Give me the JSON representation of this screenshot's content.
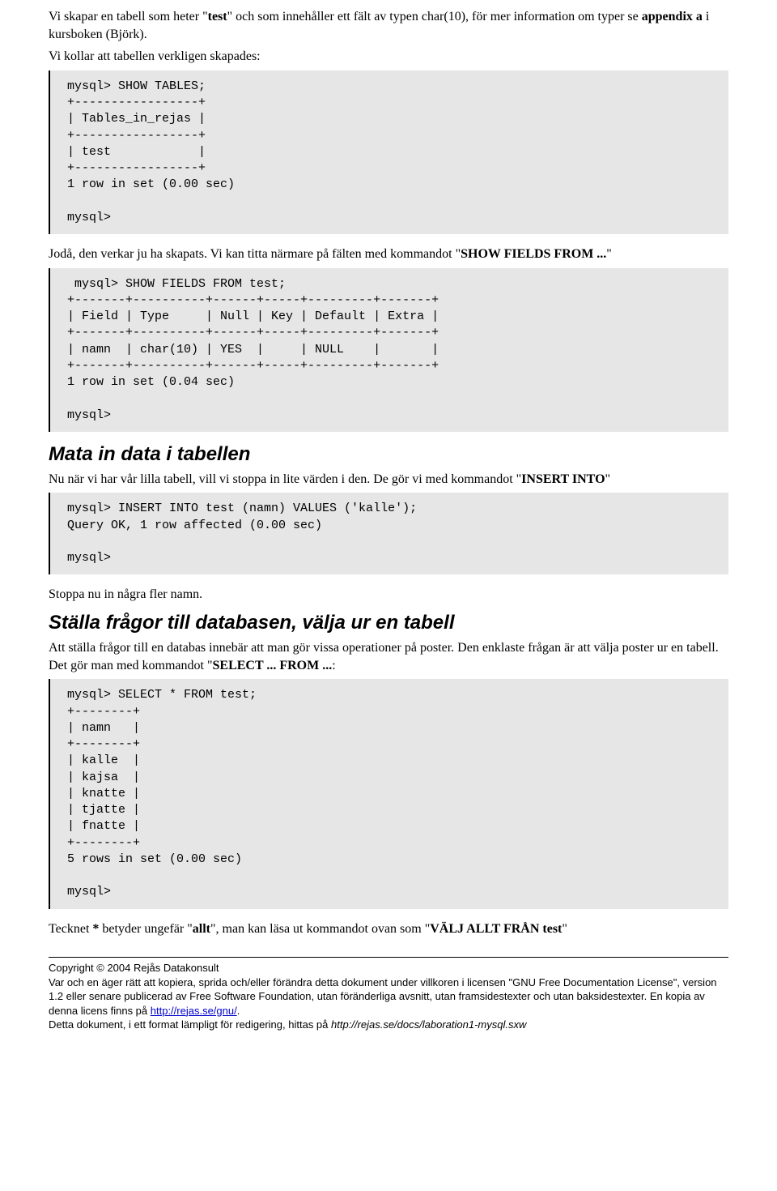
{
  "para1": {
    "pre": "Vi skapar en tabell som heter \"",
    "bold1": "test",
    "mid": "\" och som innehåller ett fält av typen char(10), för mer information om typer se ",
    "bold2": "appendix a",
    "post": " i kursboken (Björk)."
  },
  "para2": "Vi kollar att tabellen verkligen skapades:",
  "code1": " mysql> SHOW TABLES;\n +-----------------+\n | Tables_in_rejas |\n +-----------------+\n | test            |\n +-----------------+\n 1 row in set (0.00 sec)\n\n mysql>",
  "para3": {
    "pre": "Jodå, den verkar ju ha skapats. Vi kan titta närmare på fälten med kommandot \"",
    "bold1": "SHOW FIELDS FROM ...",
    "post": "\""
  },
  "code2": "  mysql> SHOW FIELDS FROM test;\n +-------+----------+------+-----+---------+-------+\n | Field | Type     | Null | Key | Default | Extra |\n +-------+----------+------+-----+---------+-------+\n | namn  | char(10) | YES  |     | NULL    |       |\n +-------+----------+------+-----+---------+-------+\n 1 row in set (0.04 sec)\n\n mysql>",
  "heading1": "Mata in data i tabellen",
  "para4": {
    "pre": "Nu när vi har vår lilla tabell, vill vi stoppa in lite värden i den. De gör vi med kommandot \"",
    "bold1": "INSERT INTO",
    "post": "\""
  },
  "code3": " mysql> INSERT INTO test (namn) VALUES ('kalle');\n Query OK, 1 row affected (0.00 sec)\n\n mysql>",
  "para5": "Stoppa nu in några fler namn.",
  "heading2": "Ställa frågor till databasen, välja ur en tabell",
  "para6": {
    "pre": "Att ställa frågor till en databas innebär att man gör vissa operationer på poster. Den enklaste frågan är att välja poster ur en tabell. Det gör man med kommandot \"",
    "bold1": "SELECT ... FROM ...",
    "post": ":"
  },
  "code4": " mysql> SELECT * FROM test;\n +--------+\n | namn   |\n +--------+\n | kalle  |\n | kajsa  |\n | knatte |\n | tjatte |\n | fnatte |\n +--------+\n 5 rows in set (0.00 sec)\n\n mysql>",
  "para7": {
    "pre": "Tecknet ",
    "bold1": "*",
    "mid": " betyder ungefär \"",
    "bold2": "allt",
    "mid2": "\", man kan läsa ut kommandot ovan som \"",
    "bold3": "VÄLJ ALLT FRÅN test",
    "post": "\""
  },
  "footer": {
    "line1": "Copyright © 2004 Rejås Datakonsult",
    "line2a": "Var och en äger rätt att kopiera, sprida och/eller förändra detta dokument under villkoren i licensen \"GNU Free Documentation License\", version 1.2 eller senare publicerad av Free Software Foundation, utan föränderliga avsnitt, utan framsidestexter och utan baksidestexter. En kopia av denna licens finns på ",
    "link1": "http://rejas.se/gnu/",
    "line2b": ".",
    "line3a": "Detta dokument, i ett format lämpligt för redigering, hittas på ",
    "link2": "http://rejas.se/docs/laboration1-mysql.sxw"
  }
}
